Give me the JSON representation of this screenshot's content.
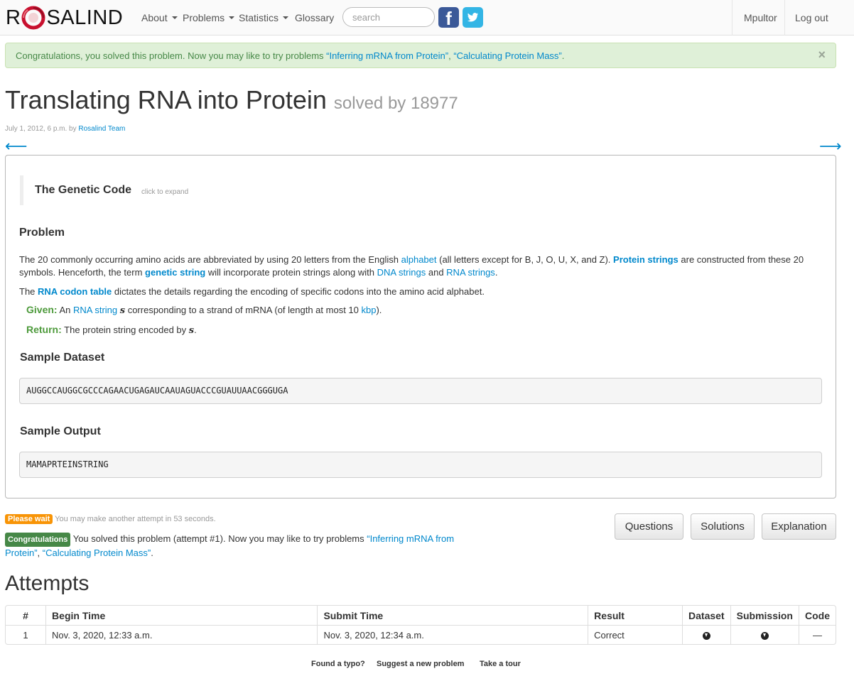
{
  "nav": {
    "brand_left": "R",
    "brand_right": "SALIND",
    "items": [
      "About",
      "Problems",
      "Statistics",
      "Glossary"
    ],
    "search_placeholder": "search",
    "user": "Mpultor",
    "logout": "Log out"
  },
  "alert": {
    "text": "Congratulations, you solved this problem. Now you may like to try problems ",
    "link1": "“Inferring mRNA from Protein”",
    "sep": ", ",
    "link2": "“Calculating Protein Mass”",
    "end": ".",
    "close": "×"
  },
  "problem": {
    "title": "Translating RNA into Protein",
    "solved_by": "solved by 18977",
    "date": "July 1, 2012, 6 p.m. by ",
    "author": "Rosalind Team",
    "prev_arrow": "⟵",
    "next_arrow": "⟶",
    "genetic_code_title": "The Genetic Code",
    "genetic_code_hint": "click to expand",
    "section_problem": "Problem",
    "para1": {
      "a": "The 20 commonly occurring amino acids are abbreviated by using 20 letters from the English ",
      "alphabet": "alphabet",
      "b": " (all letters except for B, J, O, U, X, and Z). ",
      "protein_strings": "Protein strings",
      "c": " are constructed from these 20 symbols. Henceforth, the term ",
      "genetic_string": "genetic string",
      "d": " will incorporate protein strings along with ",
      "dna_strings": "DNA strings",
      "e": " and ",
      "rna_strings": "RNA strings",
      "f": "."
    },
    "para2": {
      "a": "The ",
      "rna_codon_table": "RNA codon table",
      "b": " dictates the details regarding the encoding of specific codons into the amino acid alphabet."
    },
    "given": {
      "label": "Given:",
      "a": " An ",
      "rna_string": "RNA string",
      "b": " ",
      "s": "s",
      "c": " corresponding to a strand of mRNA (of length at most 10 ",
      "kbp": "kbp",
      "d": ")."
    },
    "return": {
      "label": "Return:",
      "a": " The protein string encoded by ",
      "s": "s",
      "b": "."
    },
    "section_sample_dataset": "Sample Dataset",
    "sample_dataset": "AUGGCCAUGGCGCCCAGAACUGAGAUCAAUAGUACCCGUAUUAACGGGUGA",
    "section_sample_output": "Sample Output",
    "sample_output": "MAMAPRTEINSTRING"
  },
  "status": {
    "wait_label": "Please wait",
    "wait_text": " You may make another attempt in 53 seconds.",
    "congrats_label": "Congratulations",
    "congrats_text": " You solved this problem (attempt #1). Now you may like to try problems ",
    "link1a": "“Inferring mRNA from",
    "link1b": "Protein”",
    "sep": ", ",
    "link2": "“Calculating Protein Mass”",
    "end": "."
  },
  "buttons": {
    "questions": "Questions",
    "solutions": "Solutions",
    "explanation": "Explanation"
  },
  "attempts": {
    "title": "Attempts",
    "headers": [
      "#",
      "Begin Time",
      "Submit Time",
      "Result",
      "Dataset",
      "Submission",
      "Code"
    ],
    "rows": [
      {
        "num": "1",
        "begin": "Nov. 3, 2020, 12:33 a.m.",
        "submit": "Nov. 3, 2020, 12:34 a.m.",
        "result": "Correct",
        "dataset_icon": "download-icon",
        "submission_icon": "download-icon",
        "code": "—"
      }
    ]
  },
  "footer": {
    "typo": "Found a typo?",
    "suggest": "Suggest a new problem",
    "tour": "Take a tour"
  },
  "colors": {
    "link": "#0088cc",
    "alert_bg": "#dff0d8",
    "alert_text": "#468847",
    "given_green": "#4d9a3b",
    "wait_orange": "#f89406",
    "logo_red": "#c8102e"
  }
}
